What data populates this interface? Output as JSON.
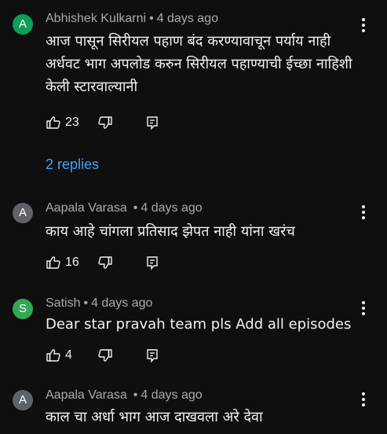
{
  "colors": {
    "background": "#0f0f0f",
    "text": "#f1f1f1",
    "meta": "#aaaaaa",
    "link": "#3ea6ff"
  },
  "icons": {
    "like": "thumb-up-icon",
    "dislike": "thumb-down-icon",
    "reply": "reply-icon",
    "menu": "more-vert-icon"
  },
  "comments": [
    {
      "avatar_letter": "A",
      "avatar_color": "#0f9d58",
      "author": "Abhishek Kulkarni",
      "separator": "•",
      "time": "4 days ago",
      "text": "आज पासून सिरीयल पहाण बंद करण्यावाचून पर्याय नाही अर्धवट भाग अपलोड करुन सिरीयल पहाण्याची ईच्छा नाहिशी केली स्टारवाल्यानी",
      "likes": "23",
      "replies_label": "2 replies"
    },
    {
      "avatar_letter": "A",
      "avatar_color": "#5f6368",
      "author": "Aapala Varasa",
      "separator": "•",
      "time": "4 days ago",
      "text": "काय आहे चांगला प्रतिसाद झेपत नाही यांना खरंच",
      "likes": "16"
    },
    {
      "avatar_letter": "S",
      "avatar_color": "#33a852",
      "author": "Satish",
      "separator": "•",
      "time": "4 days ago",
      "text": "Dear star pravah team pls Add all episodes",
      "likes": "4"
    },
    {
      "avatar_letter": "A",
      "avatar_color": "#5f6368",
      "author": "Aapala Varasa",
      "separator": "•",
      "time": "4 days ago",
      "text": "काल चा अर्धा भाग आज दाखवला अरे देवा"
    }
  ]
}
